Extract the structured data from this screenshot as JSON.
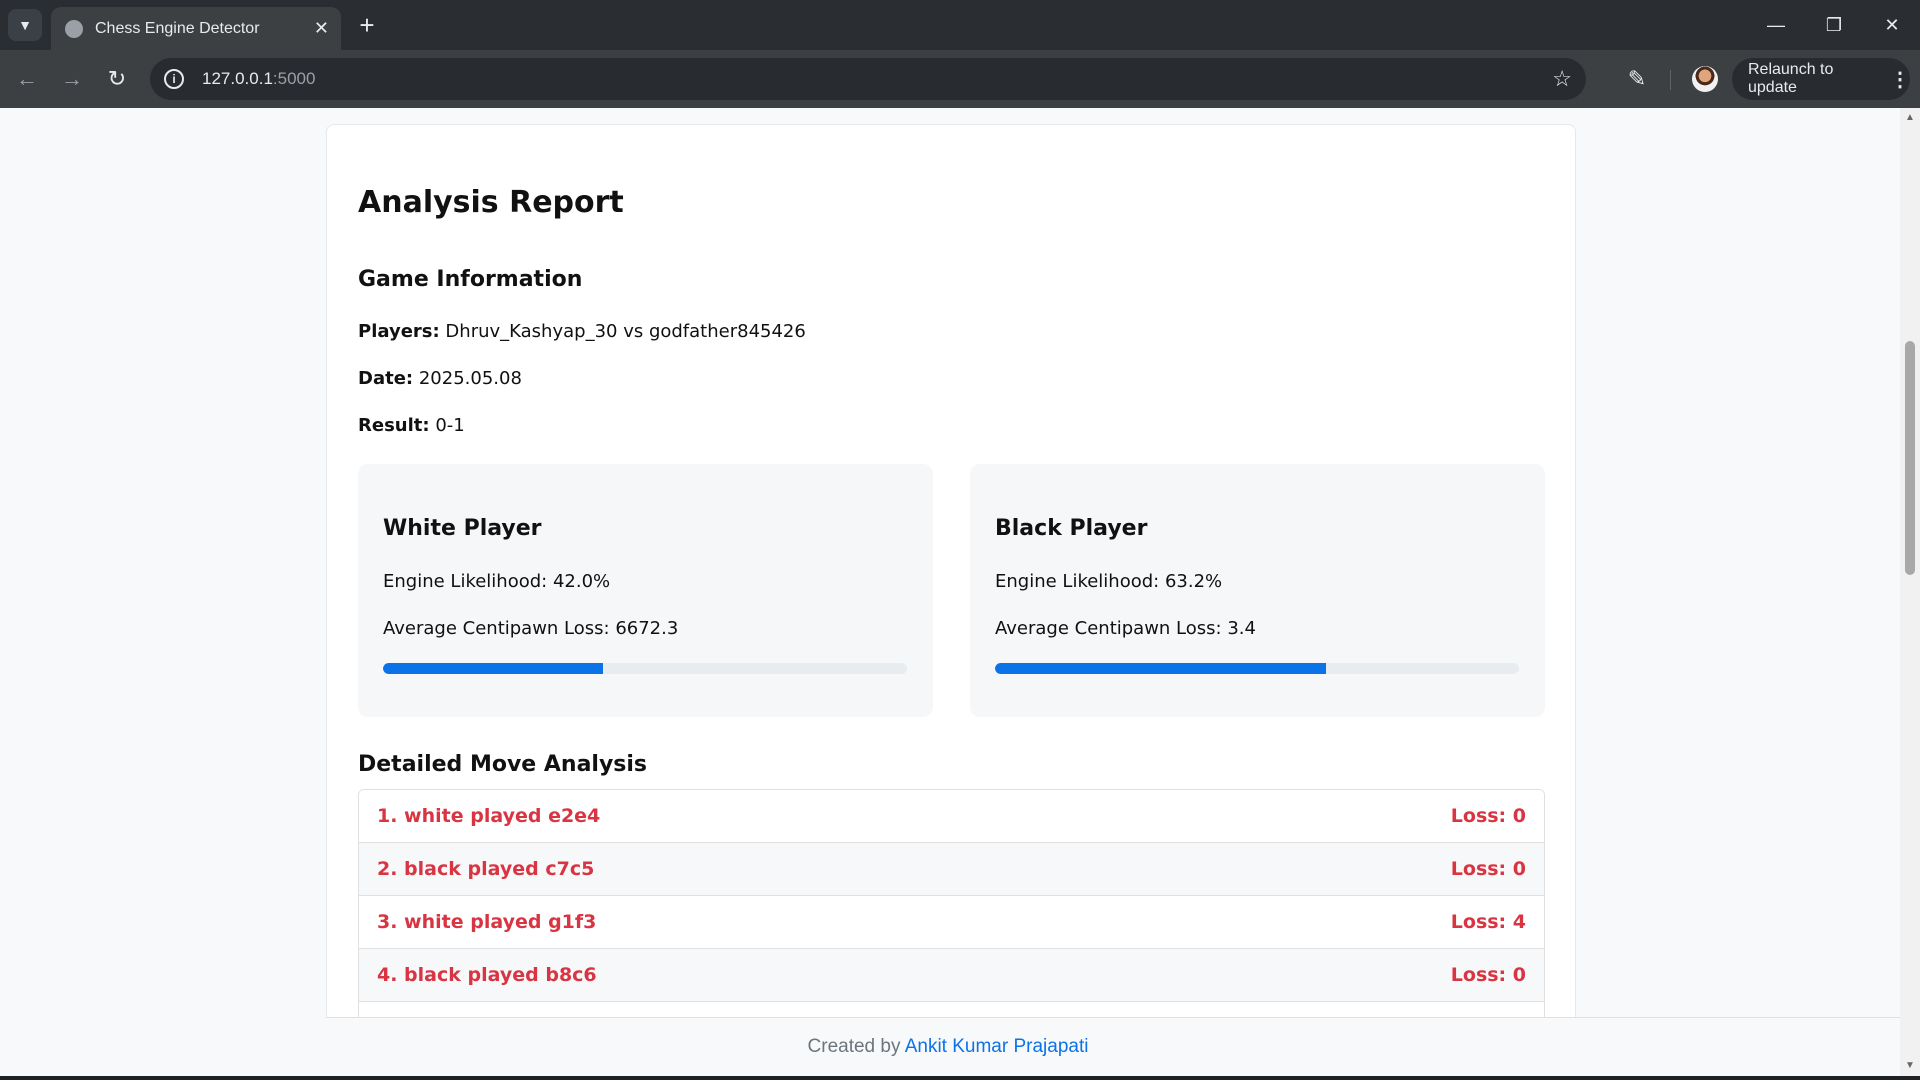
{
  "browser": {
    "tab_title": "Chess Engine Detector",
    "url_host": "127.0.0.1",
    "url_port": ":5000",
    "relaunch_label": "Relaunch to update",
    "colors": {
      "frame": "#2a2e33",
      "toolbar": "#3c4043"
    }
  },
  "report": {
    "title": "Analysis Report",
    "game_info_heading": "Game Information",
    "players_label": "Players:",
    "players_value": "Dhruv_Kashyap_30 vs godfather845426",
    "date_label": "Date:",
    "date_value": "2025.05.08",
    "result_label": "Result:",
    "result_value": "0-1"
  },
  "white": {
    "title": "White Player",
    "engine_likelihood": "Engine Likelihood: 42.0%",
    "avg_loss": "Average Centipawn Loss: 6672.3",
    "progress_percent": 42.0
  },
  "black": {
    "title": "Black Player",
    "engine_likelihood": "Engine Likelihood: 63.2%",
    "avg_loss": "Average Centipawn Loss: 3.4",
    "progress_percent": 63.2
  },
  "moves": {
    "heading": "Detailed Move Analysis",
    "rows": [
      {
        "label": "1. white played e2e4",
        "loss": "Loss: 0"
      },
      {
        "label": "2. black played c7c5",
        "loss": "Loss: 0"
      },
      {
        "label": "3. white played g1f3",
        "loss": "Loss: 4"
      },
      {
        "label": "4. black played b8c6",
        "loss": "Loss: 0"
      }
    ]
  },
  "footer": {
    "prefix": "Created by",
    "author": "Ankit Kumar Prajapati"
  },
  "accent_colors": {
    "progress": "#0b73e8",
    "move_text": "#d93442"
  }
}
